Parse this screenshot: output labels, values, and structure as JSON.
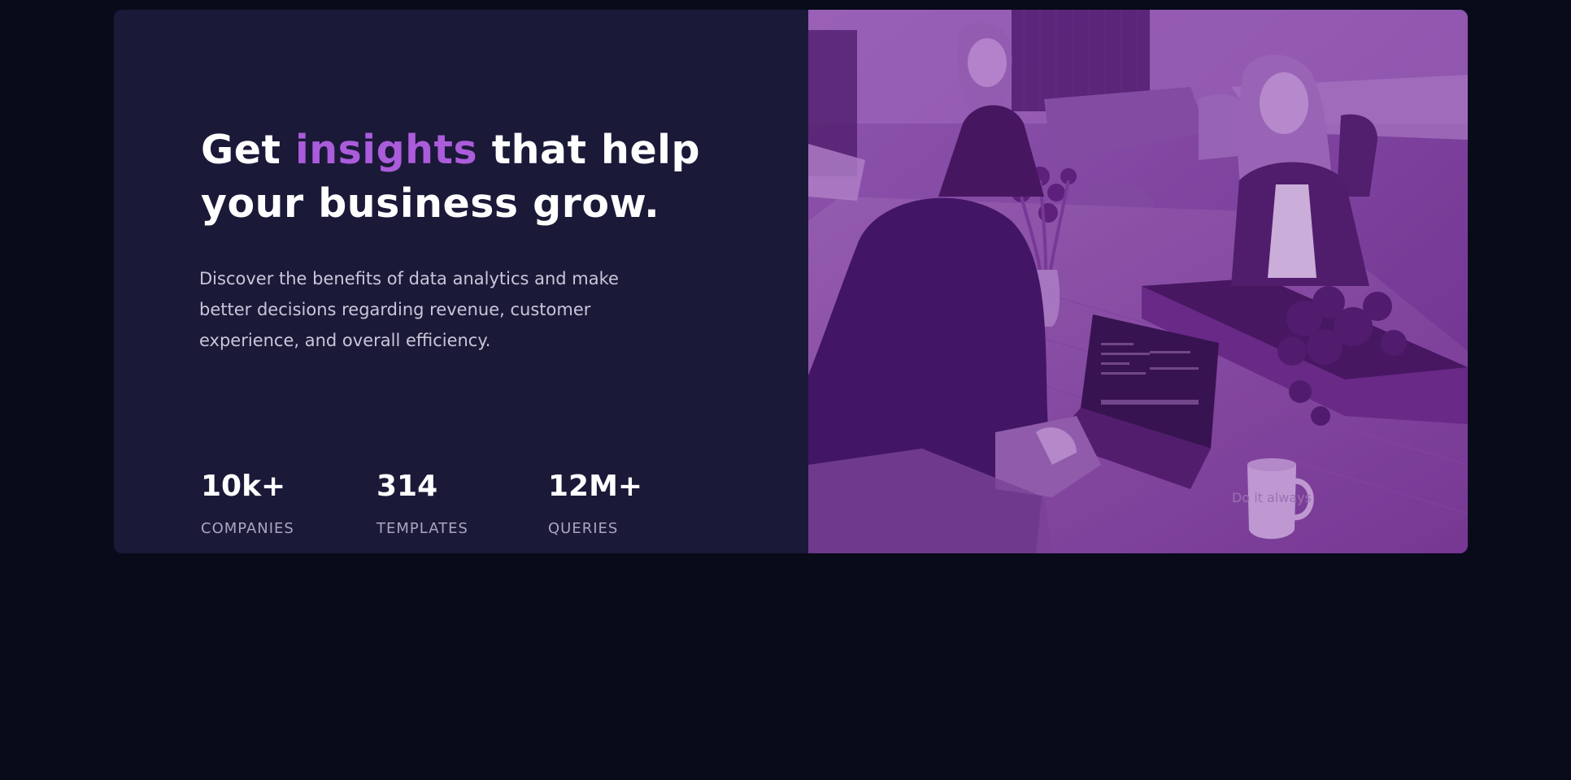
{
  "hero": {
    "headline": {
      "part1": "Get ",
      "accent": "insights",
      "part2": " that help your business grow."
    },
    "description": "Discover the benefits of data analytics and make better decisions regarding revenue, customer experience, and overall efficiency.",
    "stats": [
      {
        "value": "10k+",
        "label": "COMPANIES"
      },
      {
        "value": "314",
        "label": "TEMPLATES"
      },
      {
        "value": "12M+",
        "label": "QUERIES"
      }
    ],
    "image": {
      "mug_text": "Do it always"
    }
  },
  "colors": {
    "page_background": "#090b1a",
    "card_background": "#1b1938",
    "accent": "#aa5cdb",
    "image_overlay": "#7c3f9b",
    "heading_text": "#ffffff",
    "body_text": "#c8c6d8",
    "label_text": "#a9a6bf"
  }
}
